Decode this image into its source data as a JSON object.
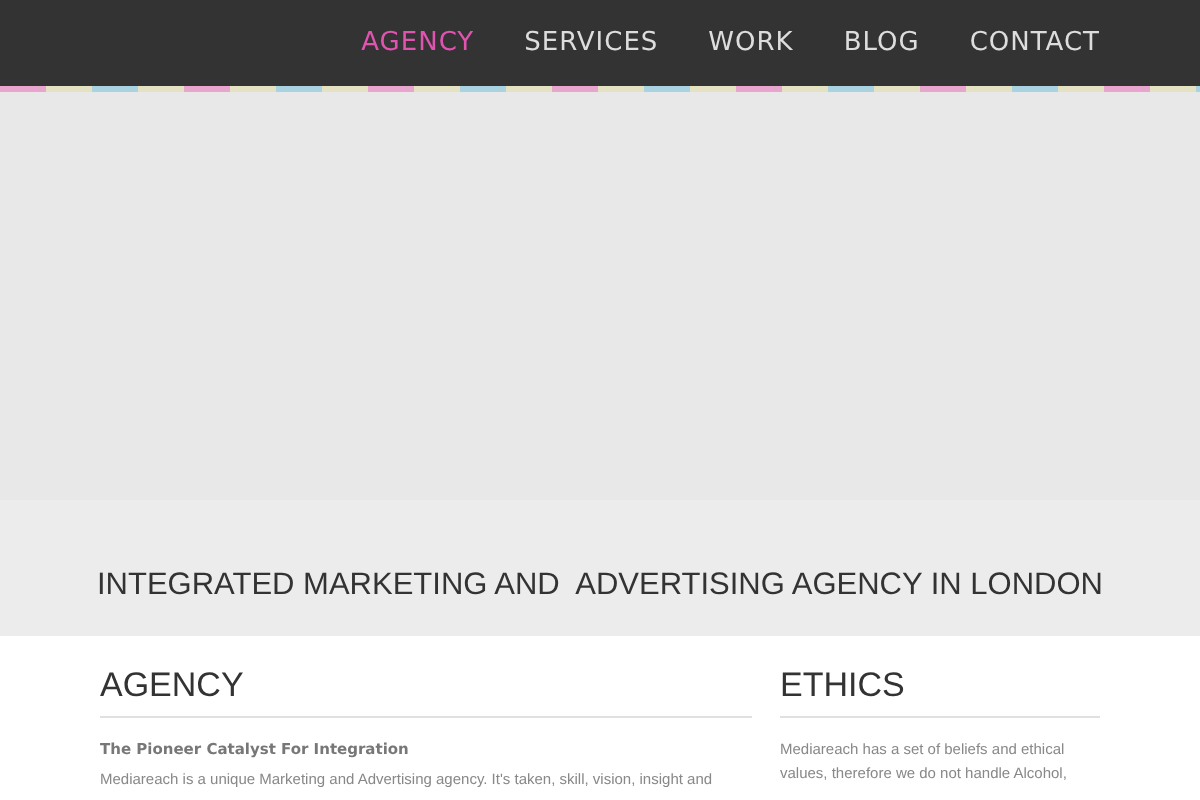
{
  "nav": {
    "items": [
      {
        "label": "AGENCY",
        "selected": true
      },
      {
        "label": "SERVICES",
        "selected": false
      },
      {
        "label": "WORK",
        "selected": false
      },
      {
        "label": "BLOG",
        "selected": false
      },
      {
        "label": "CONTACT",
        "selected": false
      }
    ]
  },
  "tagline": "INTEGRATED MARKETING AND  ADVERTISING AGENCY IN LONDON",
  "agency": {
    "heading": "AGENCY",
    "subtitle": "The Pioneer Catalyst For Integration",
    "body": "Mediareach is a unique Marketing and Advertising agency. It's taken, skill, vision, insight and"
  },
  "ethics": {
    "heading": "ETHICS",
    "body": "Mediareach has a set of beliefs and ethical values, therefore we do not handle Alcohol,"
  }
}
